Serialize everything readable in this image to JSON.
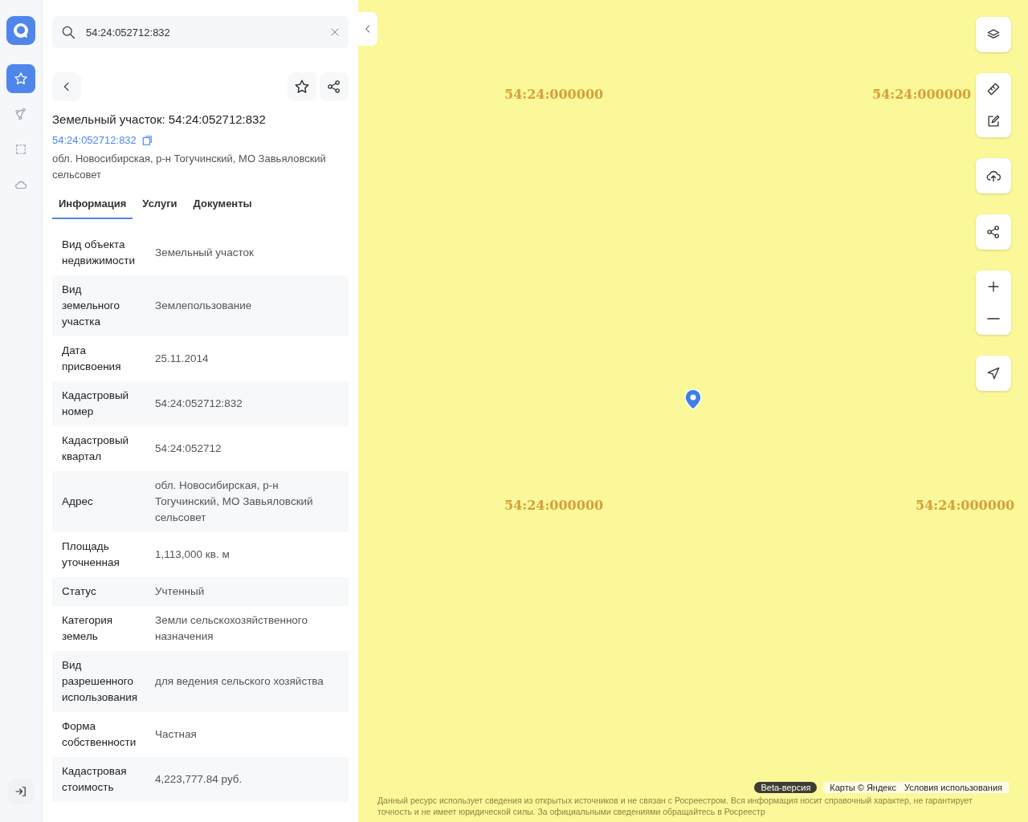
{
  "rail": {
    "items": [
      {
        "selected": true
      },
      {
        "selected": false
      },
      {
        "selected": false
      },
      {
        "selected": false
      }
    ]
  },
  "search": {
    "value": "54:24:052712:832"
  },
  "object": {
    "title": "Земельный участок: 54:24:052712:832",
    "number_link": "54:24:052712:832",
    "address": "обл. Новосибирская, р-н Тогучинский, МО Завьяловский сельсовет"
  },
  "tabs": [
    {
      "label": "Информация",
      "selected": true
    },
    {
      "label": "Услуги",
      "selected": false
    },
    {
      "label": "Документы",
      "selected": false
    }
  ],
  "info_rows": [
    {
      "label": "Вид объекта недвижимости",
      "value": "Земельный участок"
    },
    {
      "label": "Вид земельного участка",
      "value": "Землепользование"
    },
    {
      "label": "Дата присвоения",
      "value": "25.11.2014"
    },
    {
      "label": "Кадастровый номер",
      "value": "54:24:052712:832"
    },
    {
      "label": "Кадастровый квартал",
      "value": "54:24:052712"
    },
    {
      "label": "Адрес",
      "value": "обл. Новосибирская, р-н Тогучинский, МО Завьяловский сельсовет"
    },
    {
      "label": "Площадь уточненная",
      "value": "1,113,000 кв. м"
    },
    {
      "label": "Статус",
      "value": "Учтенный"
    },
    {
      "label": "Категория земель",
      "value": "Земли сельскохозяйственного назначения"
    },
    {
      "label": "Вид разрешенного использования",
      "value": "для ведения сельского хозяйства"
    },
    {
      "label": "Форма собственности",
      "value": "Частная"
    },
    {
      "label": "Кадастровая стоимость",
      "value": "4,223,777.84 руб."
    }
  ],
  "map": {
    "quarter_labels": [
      "54:24:000000",
      "54:24:000000",
      "54:24:000000",
      "54:24:000000"
    ],
    "badge": "Beta-версия",
    "attribution": "Карты © Яндекс",
    "terms_link": "Условия использования",
    "disclaimer": "Данный ресурс использует сведения из открытых источников и не связан с Росреестром. Вся информация носит справочный характер, не гарантирует точность и не имеет юридической силы. За официальными сведениями обращайтесь в Росреестр"
  }
}
